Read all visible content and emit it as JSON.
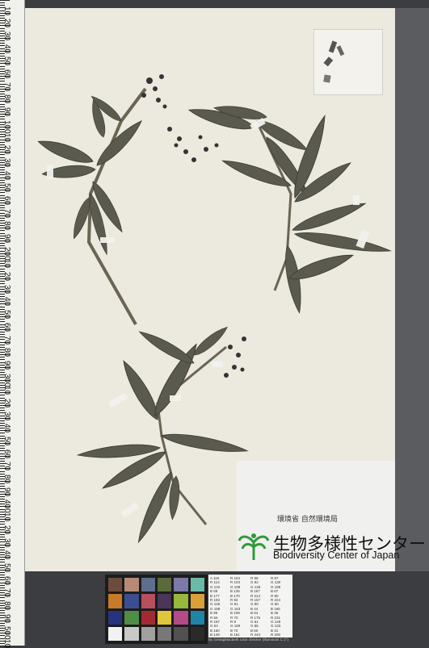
{
  "image": {
    "subject": "herbarium specimen",
    "colors": {
      "sheet": "#ece9de",
      "leaf": "#5b5a4f",
      "flower": "#3a3036",
      "tape": "#f2f2ef",
      "background": "#3b3d40"
    }
  },
  "ruler": {
    "labels": [
      "10",
      "20",
      "30",
      "40",
      "50",
      "60",
      "70",
      "80",
      "90",
      "100",
      "10",
      "20",
      "30",
      "40",
      "50",
      "60",
      "70",
      "80",
      "90",
      "200",
      "10",
      "20",
      "30",
      "40",
      "50",
      "60",
      "70",
      "80",
      "90",
      "300",
      "10",
      "20",
      "30",
      "40",
      "50",
      "60",
      "70",
      "80",
      "90",
      "400",
      "10",
      "20",
      "30",
      "40",
      "50",
      "60",
      "70",
      "80",
      "90",
      "500",
      "10"
    ]
  },
  "label": {
    "org_small": "環境省 自然環境局",
    "org_large": "生物多様性センター",
    "org_english": "Biodiversity Center of Japan"
  },
  "color_card": {
    "swatches": [
      "#6d4c3d",
      "#b88a76",
      "#5d6e8e",
      "#5b6a3b",
      "#7b79a8",
      "#6abaa8",
      "#c67a2a",
      "#3c4e92",
      "#b84f5e",
      "#4b3559",
      "#97b83a",
      "#d9a03a",
      "#273381",
      "#4e8d46",
      "#a32a33",
      "#e0c63a",
      "#b54a89",
      "#1f84a6",
      "#f2f2f2",
      "#c8c8c8",
      "#a0a0a0",
      "#787878",
      "#515151",
      "#2a2a2a"
    ]
  },
  "reference_table": {
    "cells": [
      "A 115",
      "R 154",
      "R 98",
      "R 87",
      "R 113",
      "R 103",
      "G 82",
      "G 130",
      "G 122",
      "G 108",
      "G 128",
      "G 189",
      "B 68",
      "B 135",
      "B 157",
      "B 67",
      "B 177",
      "B 170",
      "R 214",
      "R 80",
      "R 193",
      "R 94",
      "R 157",
      "R 224",
      "G 126",
      "G 91",
      "G 90",
      "G 60",
      "G 188",
      "G 163",
      "B 44",
      "B 166",
      "B 99",
      "B 108",
      "B 64",
      "B 46",
      "R 56",
      "R 70",
      "R 175",
      "R 231",
      "R 187",
      "R 8",
      "G 61",
      "G 149",
      "G 54",
      "G 199",
      "G 86",
      "G 133",
      "B 150",
      "B 73",
      "B 60",
      "B 31",
      "B 149",
      "B 161",
      "R 243",
      "R 200",
      "R 160",
      "R 122",
      "R 85",
      "R 52",
      "G 243",
      "G 200",
      "G 160",
      "G 122",
      "G 85",
      "G 52",
      "B 242",
      "B 200",
      "B 160",
      "B 121",
      "B 85",
      "B 52"
    ],
    "caption": "By GretagMacbeth color checker (Illuminant C 2°)"
  }
}
